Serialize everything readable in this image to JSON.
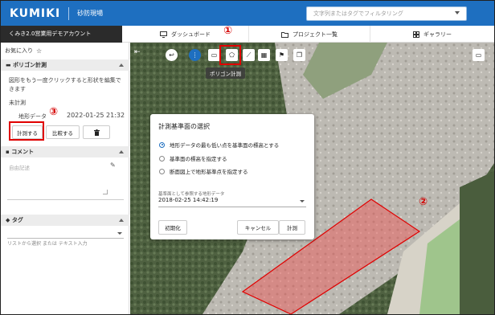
{
  "app": {
    "logo": "KUMIKI",
    "site": "砂防現場",
    "account": "くみき2.0営業用デモアカウント"
  },
  "search": {
    "placeholder": "文字列またはタグでフィルタリング"
  },
  "nav": {
    "tabs": [
      {
        "label": "ダッシュボード",
        "icon": "monitor-icon"
      },
      {
        "label": "プロジェクト一覧",
        "icon": "folder-icon"
      },
      {
        "label": "ギャラリー",
        "icon": "grid-icon"
      }
    ]
  },
  "sidebar": {
    "favorite": "お気に入り",
    "polygon": {
      "title": "ポリゴン計測",
      "instruction": "図形をもう一度クリックすると形状を編集できます",
      "status": "未計測",
      "terrain_label": "地形データ",
      "date": "2022-01-25 21:32",
      "measure_button": "計測する",
      "compare_button": "比較する"
    },
    "comment": {
      "title": "コメント",
      "placeholder": "自由記述"
    },
    "tag": {
      "title": "タグ",
      "placeholder": "リストから選択 または テキスト入力"
    }
  },
  "toolbar": {
    "tooltip": "ポリゴン計測"
  },
  "dialog": {
    "title": "計測基準面の選択",
    "options": [
      "地形データの最も低い点を基準面の標高とする",
      "基準面の標高を指定する",
      "断面図上で地形基準点を指定する"
    ],
    "selected_index": 0,
    "dataset_label": "基準面として参照する地形データ",
    "dataset_value": "2018-02-25 14:42:19",
    "reset": "初期化",
    "cancel": "キャンセル",
    "submit": "計測"
  },
  "annotations": {
    "m1": "①",
    "m2": "②",
    "m3": "③"
  },
  "colors": {
    "brand": "#1e6fc0",
    "highlight": "#e00000"
  }
}
